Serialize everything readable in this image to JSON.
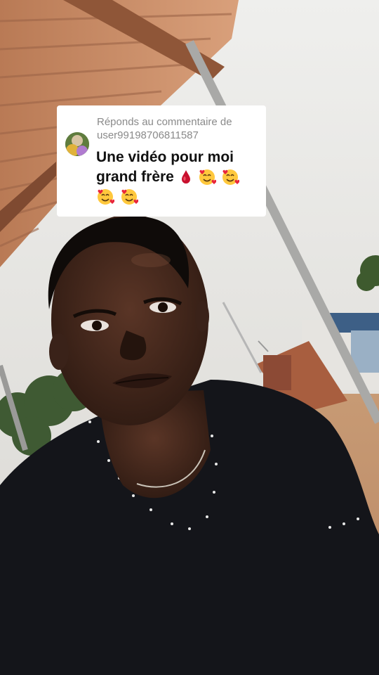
{
  "video": {
    "scene_description_icon": "selfie-video-frame"
  },
  "comment_reply": {
    "reply_prefix": "Réponds au commentaire de",
    "username": "user99198706811587",
    "comment_text_line1": "Une vidéo pour moi",
    "comment_text_line2": "grand frère",
    "emojis": [
      "blood-drop-icon",
      "smiling-face-with-hearts-icon",
      "smiling-face-with-hearts-icon",
      "smiling-face-with-hearts-icon",
      "smiling-face-with-hearts-icon"
    ]
  },
  "colors": {
    "card_bg": "#ffffff",
    "reply_text": "#8a8a8a",
    "comment_text": "#111111"
  }
}
